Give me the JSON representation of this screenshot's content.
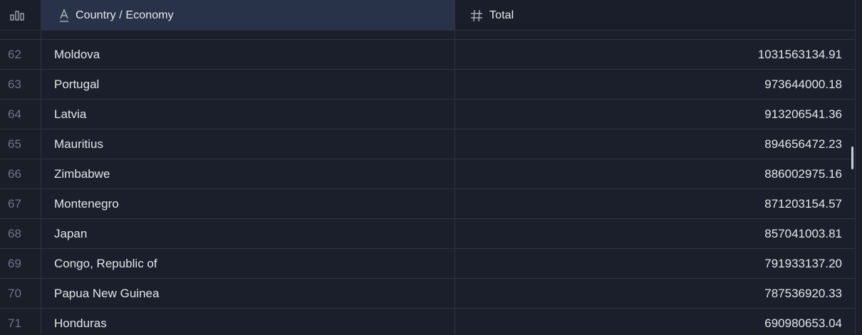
{
  "header": {
    "index_icon": "bar-chart-icon",
    "columns": [
      {
        "label": "Country / Economy",
        "icon": "text-type-icon"
      },
      {
        "label": "Total",
        "icon": "hash-number-icon"
      }
    ]
  },
  "rows": [
    {
      "index": "62",
      "country": "Moldova",
      "total": "1031563134.91"
    },
    {
      "index": "63",
      "country": "Portugal",
      "total": "973644000.18"
    },
    {
      "index": "64",
      "country": "Latvia",
      "total": "913206541.36"
    },
    {
      "index": "65",
      "country": "Mauritius",
      "total": "894656472.23"
    },
    {
      "index": "66",
      "country": "Zimbabwe",
      "total": "886002975.16"
    },
    {
      "index": "67",
      "country": "Montenegro",
      "total": "871203154.57"
    },
    {
      "index": "68",
      "country": "Japan",
      "total": "857041003.81"
    },
    {
      "index": "69",
      "country": "Congo, Republic of",
      "total": "791933137.20"
    },
    {
      "index": "70",
      "country": "Papua New Guinea",
      "total": "787536920.33"
    },
    {
      "index": "71",
      "country": "Honduras",
      "total": "690980653.04"
    }
  ],
  "colors": {
    "background": "#1b1f2b",
    "header_selected": "#283249",
    "grid_line": "#2c3342",
    "index_text": "#6e7686",
    "cell_text": "#e1e5ec"
  }
}
